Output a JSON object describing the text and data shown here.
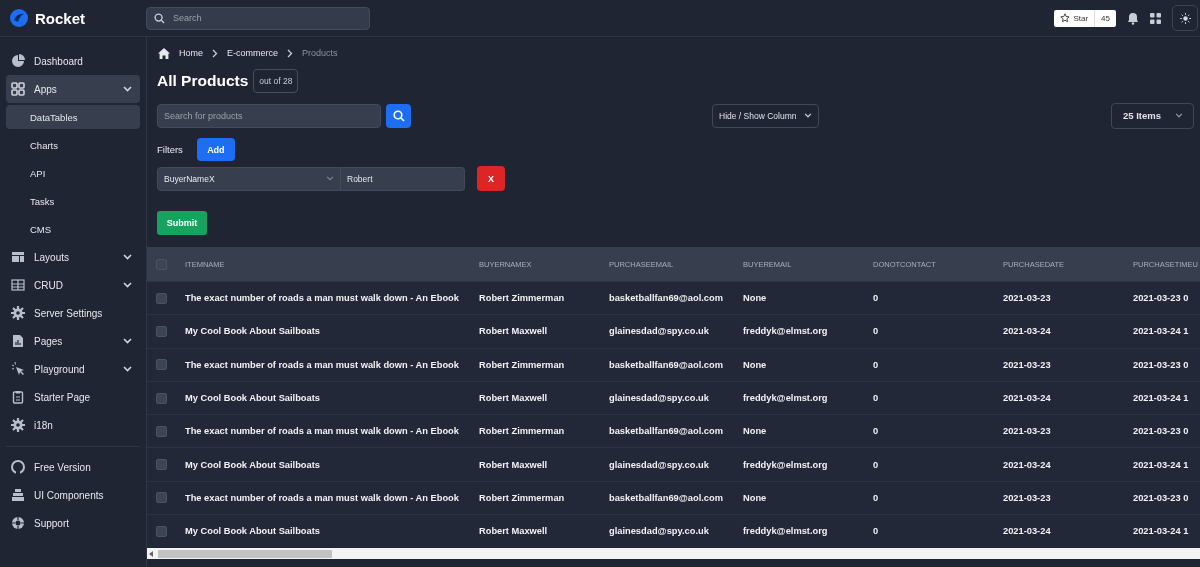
{
  "topbar": {
    "brand": "Rocket",
    "search": {
      "placeholder": "Search"
    },
    "star": {
      "label": "Star",
      "count": "45"
    }
  },
  "sidebar": {
    "items": [
      {
        "label": "Dashboard",
        "kind": "link",
        "selected": false
      },
      {
        "label": "Apps",
        "kind": "group",
        "selected": true,
        "children": [
          {
            "label": "DataTables",
            "selected": true
          },
          {
            "label": "Charts",
            "selected": false
          },
          {
            "label": "API",
            "selected": false
          },
          {
            "label": "Tasks",
            "selected": false
          },
          {
            "label": "CMS",
            "selected": false
          }
        ]
      },
      {
        "label": "Layouts",
        "kind": "group",
        "selected": false
      },
      {
        "label": "CRUD",
        "kind": "group",
        "selected": false
      },
      {
        "label": "Server Settings",
        "kind": "link",
        "selected": false
      },
      {
        "label": "Pages",
        "kind": "group",
        "selected": false
      },
      {
        "label": "Playground",
        "kind": "group",
        "selected": false
      },
      {
        "label": "Starter Page",
        "kind": "link",
        "selected": false
      },
      {
        "label": "i18n",
        "kind": "link",
        "selected": false
      }
    ],
    "footer": [
      {
        "label": "Free Version"
      },
      {
        "label": "UI Components"
      },
      {
        "label": "Support"
      }
    ]
  },
  "breadcrumb": [
    {
      "label": "Home",
      "current": false
    },
    {
      "label": "E-commerce",
      "current": false
    },
    {
      "label": "Products",
      "current": true
    }
  ],
  "page": {
    "title": "All Products",
    "count": "out of 28"
  },
  "search": {
    "placeholder": "Search for products"
  },
  "column_toggle": {
    "label": "Hide / Show Column"
  },
  "page_size": {
    "label": "25 Items"
  },
  "filters": {
    "label": "Filters",
    "add": "Add",
    "rows": [
      {
        "field": "BuyerNameX",
        "value": "Robert",
        "remove": "X"
      }
    ],
    "submit": "Submit"
  },
  "table": {
    "columns": [
      "ITEMNAME",
      "BUYERNAMEX",
      "PURCHASEEMAIL",
      "BUYEREMAIL",
      "DONOTCONTACT",
      "PURCHASEDATE",
      "PURCHASETIMEU"
    ],
    "header_checked": false,
    "rows": [
      {
        "checked": false,
        "cells": [
          "The exact number of roads a man must walk down - An Ebook",
          "Robert Zimmerman",
          "basketballfan69@aol.com",
          "None",
          "0",
          "2021-03-23",
          "2021-03-23 0"
        ]
      },
      {
        "checked": false,
        "cells": [
          "My Cool Book About Sailboats",
          "Robert Maxwell",
          "glainesdad@spy.co.uk",
          "freddyk@elmst.org",
          "0",
          "2021-03-24",
          "2021-03-24 1"
        ]
      },
      {
        "checked": false,
        "cells": [
          "The exact number of roads a man must walk down - An Ebook",
          "Robert Zimmerman",
          "basketballfan69@aol.com",
          "None",
          "0",
          "2021-03-23",
          "2021-03-23 0"
        ]
      },
      {
        "checked": false,
        "cells": [
          "My Cool Book About Sailboats",
          "Robert Maxwell",
          "glainesdad@spy.co.uk",
          "freddyk@elmst.org",
          "0",
          "2021-03-24",
          "2021-03-24 1"
        ]
      },
      {
        "checked": false,
        "cells": [
          "The exact number of roads a man must walk down - An Ebook",
          "Robert Zimmerman",
          "basketballfan69@aol.com",
          "None",
          "0",
          "2021-03-23",
          "2021-03-23 0"
        ]
      },
      {
        "checked": false,
        "cells": [
          "My Cool Book About Sailboats",
          "Robert Maxwell",
          "glainesdad@spy.co.uk",
          "freddyk@elmst.org",
          "0",
          "2021-03-24",
          "2021-03-24 1"
        ]
      },
      {
        "checked": false,
        "cells": [
          "The exact number of roads a man must walk down - An Ebook",
          "Robert Zimmerman",
          "basketballfan69@aol.com",
          "None",
          "0",
          "2021-03-23",
          "2021-03-23 0"
        ]
      },
      {
        "checked": false,
        "cells": [
          "My Cool Book About Sailboats",
          "Robert Maxwell",
          "glainesdad@spy.co.uk",
          "freddyk@elmst.org",
          "0",
          "2021-03-24",
          "2021-03-24 1"
        ]
      }
    ]
  }
}
